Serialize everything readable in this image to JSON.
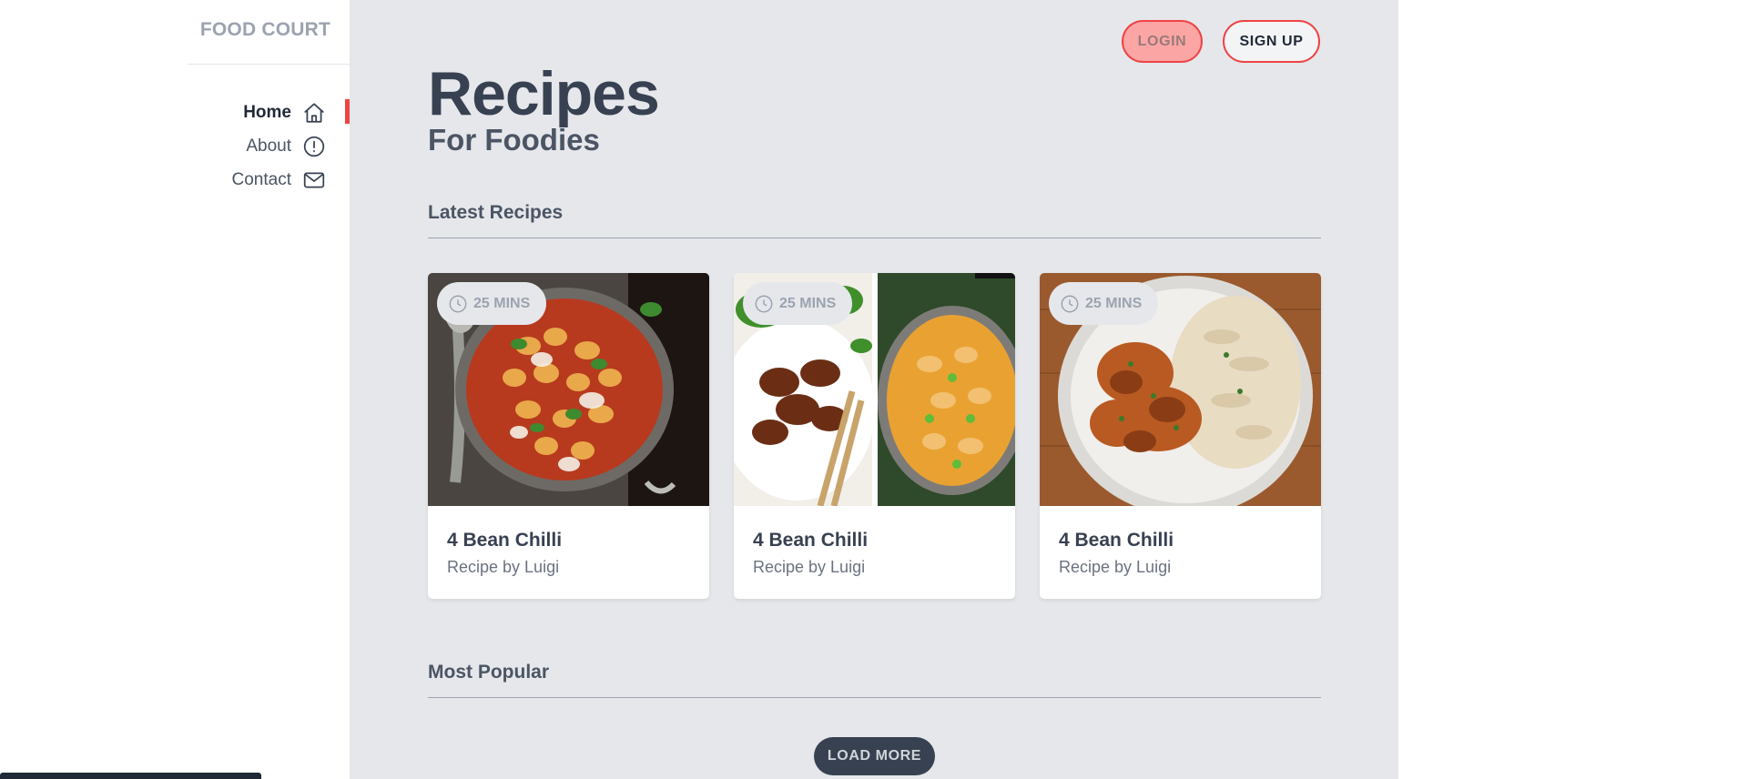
{
  "brand": {
    "name": "FOOD COURT"
  },
  "nav": {
    "items": [
      {
        "label": "Home",
        "icon": "home-icon",
        "active": true
      },
      {
        "label": "About",
        "icon": "info-icon",
        "active": false
      },
      {
        "label": "Contact",
        "icon": "mail-icon",
        "active": false
      }
    ]
  },
  "header": {
    "login_label": "LOGIN",
    "signup_label": "SIGN UP",
    "title": "Recipes",
    "subtitle": "For Foodies"
  },
  "sections": {
    "latest": "Latest Recipes",
    "popular": "Most Popular"
  },
  "recipes": [
    {
      "time": "25 MINS",
      "name": "4 Bean Chilli",
      "author": "Recipe by Luigi",
      "image": "gnocchi-pan-photo"
    },
    {
      "time": "25 MINS",
      "name": "4 Bean Chilli",
      "author": "Recipe by Luigi",
      "image": "chicken-and-curry-photo"
    },
    {
      "time": "25 MINS",
      "name": "4 Bean Chilli",
      "author": "Recipe by Luigi",
      "image": "curry-rice-bowl-photo"
    }
  ],
  "load_more_label": "LOAD MORE",
  "colors": {
    "accent": "#ef4444",
    "panel": "#e5e7eb",
    "text": "#374151"
  }
}
